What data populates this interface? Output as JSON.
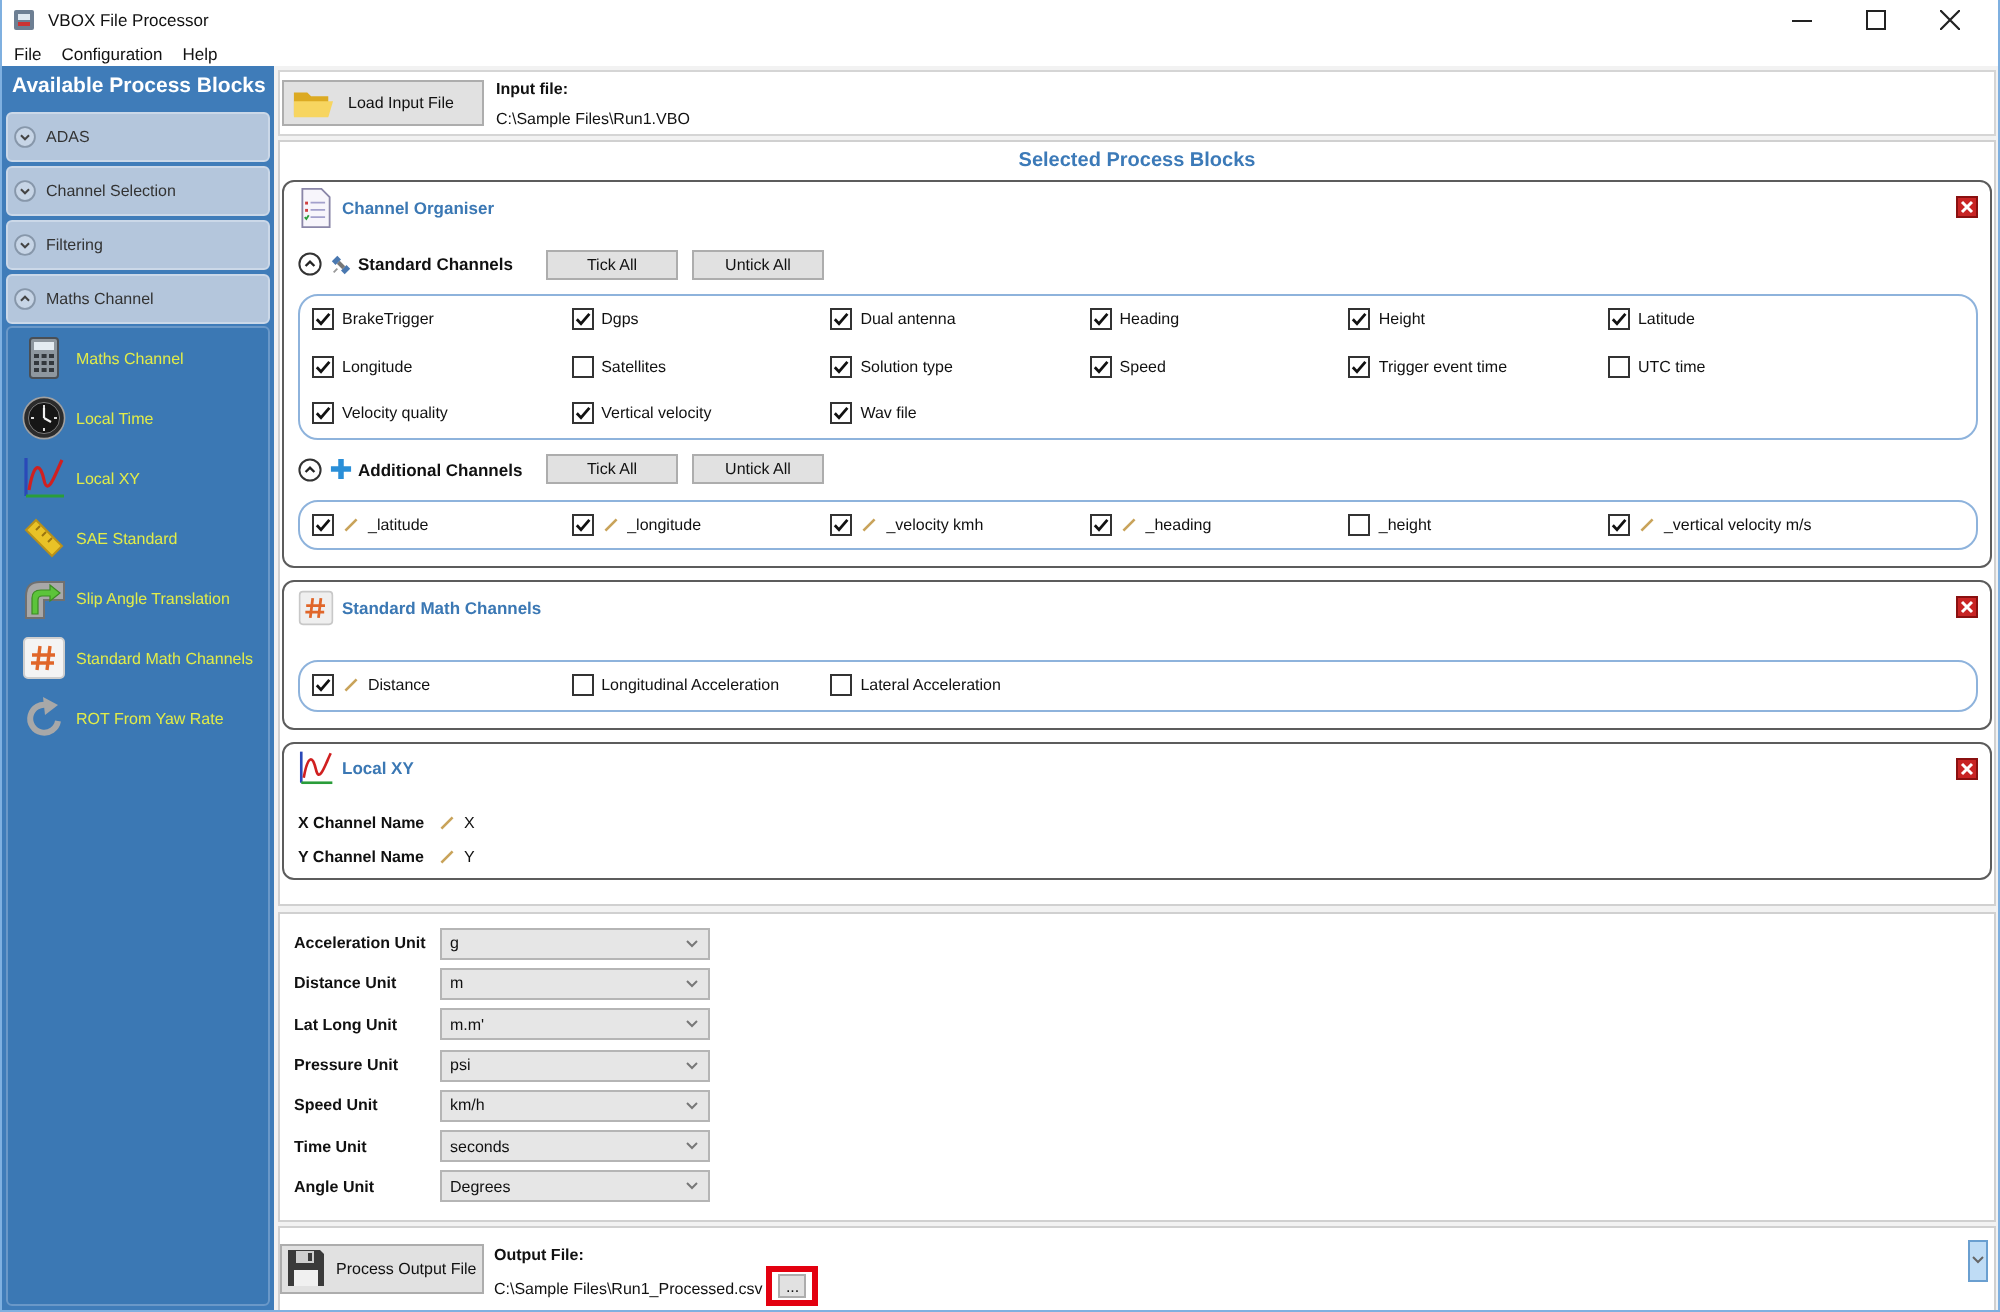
{
  "window": {
    "title": "VBOX File Processor"
  },
  "menu": [
    "File",
    "Configuration",
    "Help"
  ],
  "sidebar": {
    "title": "Available Process Blocks",
    "groups": [
      {
        "label": "ADAS",
        "expanded": false
      },
      {
        "label": "Channel Selection",
        "expanded": false
      },
      {
        "label": "Filtering",
        "expanded": false
      },
      {
        "label": "Maths Channel",
        "expanded": true,
        "items": [
          "Maths Channel",
          "Local Time",
          "Local XY",
          "SAE Standard",
          "Slip Angle Translation",
          "Standard Math Channels",
          "ROT From Yaw Rate"
        ]
      }
    ]
  },
  "input": {
    "button": "Load Input File",
    "label": "Input file:",
    "path": "C:\\Sample Files\\Run1.VBO"
  },
  "process_blocks": {
    "title": "Selected Process Blocks",
    "blocks": [
      {
        "kind": "channel_organiser",
        "title": "Channel Organiser",
        "sections": [
          {
            "title": "Standard Channels",
            "expanded": true,
            "buttons": [
              "Tick All",
              "Untick All"
            ],
            "channels": [
              {
                "label": "BrakeTrigger",
                "checked": true
              },
              {
                "label": "Dgps",
                "checked": true
              },
              {
                "label": "Dual antenna",
                "checked": true
              },
              {
                "label": "Heading",
                "checked": true
              },
              {
                "label": "Height",
                "checked": true
              },
              {
                "label": "Latitude",
                "checked": true
              },
              {
                "label": "Longitude",
                "checked": true
              },
              {
                "label": "Satellites",
                "checked": false
              },
              {
                "label": "Solution type",
                "checked": true
              },
              {
                "label": "Speed",
                "checked": true
              },
              {
                "label": "Trigger event time",
                "checked": true
              },
              {
                "label": "UTC time",
                "checked": false
              },
              {
                "label": "Velocity quality",
                "checked": true
              },
              {
                "label": "Vertical velocity",
                "checked": true
              },
              {
                "label": "Wav file",
                "checked": true
              }
            ]
          },
          {
            "title": "Additional Channels",
            "expanded": true,
            "buttons": [
              "Tick All",
              "Untick All"
            ],
            "channels": [
              {
                "label": "_latitude",
                "checked": true,
                "editable": true
              },
              {
                "label": "_longitude",
                "checked": true,
                "editable": true
              },
              {
                "label": "_velocity kmh",
                "checked": true,
                "editable": true
              },
              {
                "label": "_heading",
                "checked": true,
                "editable": true
              },
              {
                "label": "_height",
                "checked": false,
                "editable": false
              },
              {
                "label": "_vertical velocity m/s",
                "checked": true,
                "editable": true
              }
            ]
          }
        ]
      },
      {
        "kind": "math",
        "title": "Standard Math Channels",
        "channels": [
          {
            "label": "Distance",
            "checked": true,
            "editable": true
          },
          {
            "label": "Longitudinal Acceleration",
            "checked": false,
            "editable": false
          },
          {
            "label": "Lateral Acceleration",
            "checked": false,
            "editable": false
          }
        ]
      },
      {
        "kind": "local_xy",
        "title": "Local XY",
        "fields": [
          {
            "label": "X Channel Name",
            "value": "X"
          },
          {
            "label": "Y Channel Name",
            "value": "Y"
          }
        ]
      }
    ]
  },
  "units": [
    {
      "label": "Acceleration Unit",
      "value": "g"
    },
    {
      "label": "Distance Unit",
      "value": "m"
    },
    {
      "label": "Lat Long Unit",
      "value": "m.m'"
    },
    {
      "label": "Pressure Unit",
      "value": "psi"
    },
    {
      "label": "Speed Unit",
      "value": "km/h"
    },
    {
      "label": "Time Unit",
      "value": "seconds"
    },
    {
      "label": "Angle Unit",
      "value": "Degrees"
    }
  ],
  "output": {
    "button": "Process Output File",
    "label": "Output File:",
    "path": "C:\\Sample Files\\Run1_Processed.csv",
    "browse_button": "..."
  }
}
